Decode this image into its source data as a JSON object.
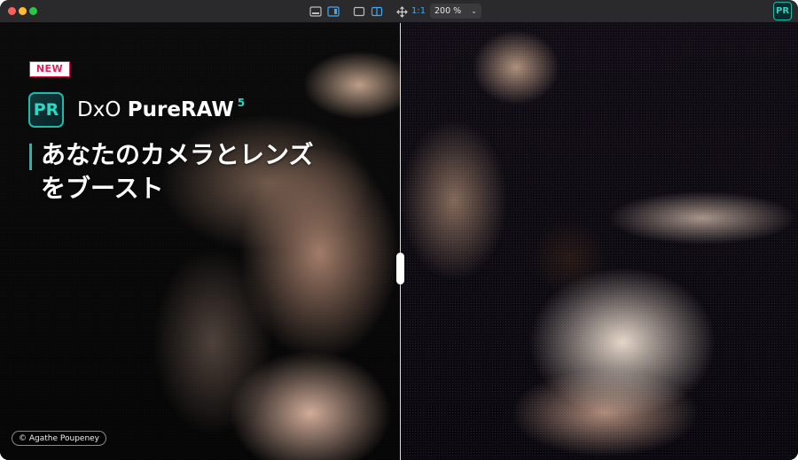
{
  "toolbar": {
    "one_to_one_label": "1:1",
    "zoom_value": "200 %",
    "app_badge": "PR"
  },
  "overlay": {
    "new_badge": "NEW",
    "logo_text": "PR",
    "brand": "DxO",
    "product_name": "PureRAW",
    "version": "5",
    "tagline_line1": "あなたのカメラとレンズ",
    "tagline_line2": "をブースト",
    "credit": "© Agathe Poupeney"
  },
  "colors": {
    "accent_teal": "#21b9aa",
    "new_badge_red": "#e11d5a",
    "toolbar_blue": "#3fa9f5",
    "titlebar": "#2a2a2c"
  }
}
